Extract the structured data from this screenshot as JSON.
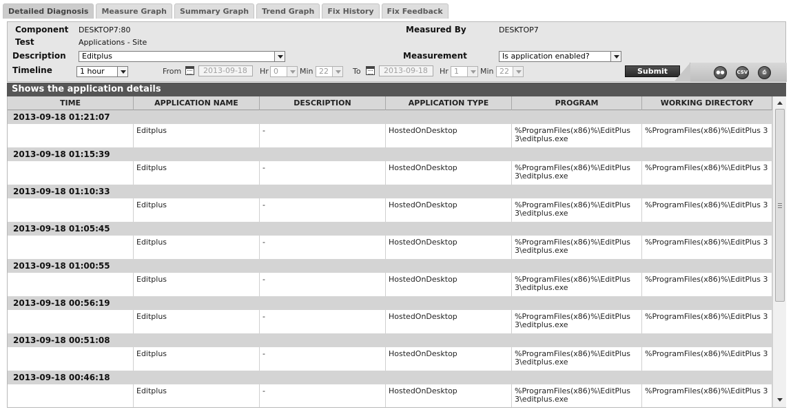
{
  "tabs": [
    {
      "label": "Detailed Diagnosis",
      "active": true
    },
    {
      "label": "Measure Graph",
      "active": false
    },
    {
      "label": "Summary Graph",
      "active": false
    },
    {
      "label": "Trend Graph",
      "active": false
    },
    {
      "label": "Fix History",
      "active": false
    },
    {
      "label": "Fix Feedback",
      "active": false
    }
  ],
  "filters": {
    "component_label": "Component",
    "component_value": "DESKTOP7:80",
    "test_label": "Test",
    "test_value": "Applications - Site",
    "description_label": "Description",
    "description_value": "Editplus",
    "measured_by_label": "Measured By",
    "measured_by_value": "DESKTOP7",
    "measurement_label": "Measurement",
    "measurement_value": "Is application enabled?",
    "timeline_label": "Timeline",
    "timeline_value": "1 hour",
    "from_label": "From",
    "from_date": "2013-09-18",
    "from_hr_label": "Hr",
    "from_hr": "0",
    "from_min_label": "Min",
    "from_min": "22",
    "to_label": "To",
    "to_date": "2013-09-18",
    "to_hr_label": "Hr",
    "to_hr": "1",
    "to_min_label": "Min",
    "to_min": "22",
    "submit_label": "Submit"
  },
  "toolbar_icons": [
    {
      "name": "binoculars-icon",
      "glyph": "●●"
    },
    {
      "name": "csv-icon",
      "glyph": "CSV"
    },
    {
      "name": "print-icon",
      "glyph": "⎙"
    }
  ],
  "table": {
    "title": "Shows the application details",
    "columns": [
      "TIME",
      "APPLICATION NAME",
      "DESCRIPTION",
      "APPLICATION TYPE",
      "PROGRAM",
      "WORKING DIRECTORY"
    ],
    "groups": [
      {
        "time": "2013-09-18 01:21:07",
        "row": [
          "",
          "Editplus",
          "-",
          "HostedOnDesktop",
          "%ProgramFiles(x86)%\\EditPlus 3\\editplus.exe",
          "%ProgramFiles(x86)%\\EditPlus 3"
        ]
      },
      {
        "time": "2013-09-18 01:15:39",
        "row": [
          "",
          "Editplus",
          "-",
          "HostedOnDesktop",
          "%ProgramFiles(x86)%\\EditPlus 3\\editplus.exe",
          "%ProgramFiles(x86)%\\EditPlus 3"
        ]
      },
      {
        "time": "2013-09-18 01:10:33",
        "row": [
          "",
          "Editplus",
          "-",
          "HostedOnDesktop",
          "%ProgramFiles(x86)%\\EditPlus 3\\editplus.exe",
          "%ProgramFiles(x86)%\\EditPlus 3"
        ]
      },
      {
        "time": "2013-09-18 01:05:45",
        "row": [
          "",
          "Editplus",
          "-",
          "HostedOnDesktop",
          "%ProgramFiles(x86)%\\EditPlus 3\\editplus.exe",
          "%ProgramFiles(x86)%\\EditPlus 3"
        ]
      },
      {
        "time": "2013-09-18 01:00:55",
        "row": [
          "",
          "Editplus",
          "-",
          "HostedOnDesktop",
          "%ProgramFiles(x86)%\\EditPlus 3\\editplus.exe",
          "%ProgramFiles(x86)%\\EditPlus 3"
        ]
      },
      {
        "time": "2013-09-18 00:56:19",
        "row": [
          "",
          "Editplus",
          "-",
          "HostedOnDesktop",
          "%ProgramFiles(x86)%\\EditPlus 3\\editplus.exe",
          "%ProgramFiles(x86)%\\EditPlus 3"
        ]
      },
      {
        "time": "2013-09-18 00:51:08",
        "row": [
          "",
          "Editplus",
          "-",
          "HostedOnDesktop",
          "%ProgramFiles(x86)%\\EditPlus 3\\editplus.exe",
          "%ProgramFiles(x86)%\\EditPlus 3"
        ]
      },
      {
        "time": "2013-09-18 00:46:18",
        "row": [
          "",
          "Editplus",
          "-",
          "HostedOnDesktop",
          "%ProgramFiles(x86)%\\EditPlus 3\\editplus.exe",
          "%ProgramFiles(x86)%\\EditPlus 3"
        ]
      }
    ]
  }
}
